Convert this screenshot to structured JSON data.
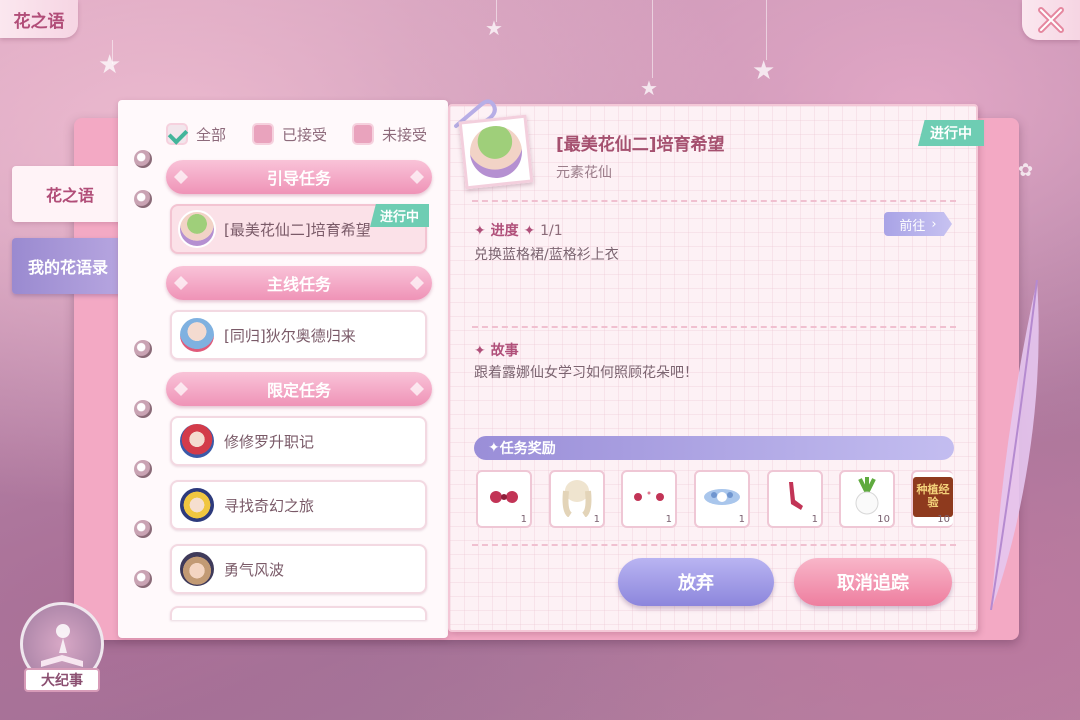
{
  "header": {
    "title": "花之语"
  },
  "side_tabs": [
    {
      "label": "花之语"
    },
    {
      "label": "我的花语录"
    }
  ],
  "filters": [
    {
      "label": "全部",
      "checked": true
    },
    {
      "label": "已接受",
      "checked": false
    },
    {
      "label": "未接受",
      "checked": false
    }
  ],
  "categories": [
    {
      "label": "引导任务"
    },
    {
      "label": "主线任务"
    },
    {
      "label": "限定任务"
    }
  ],
  "quests": [
    {
      "title": "[最美花仙二]培育希望",
      "status": "进行中",
      "selected": true
    },
    {
      "title": "[同归]狄尔奥德归来"
    },
    {
      "title": "修修罗升职记"
    },
    {
      "title": "寻找奇幻之旅"
    },
    {
      "title": "勇气风波"
    }
  ],
  "detail": {
    "title": "[最美花仙二]培育希望",
    "subtitle": "元素花仙",
    "status": "进行中",
    "progress_label": "进度",
    "progress_value": "1/1",
    "goto_label": "前往",
    "task_text": "兑换蓝格裙/蓝格衫上衣",
    "story_label": "故事",
    "story_text": "跟着露娜仙女学习如何照顾花朵吧！",
    "reward_label": "任务奖励",
    "rewards": [
      {
        "icon": "red-bow-icon",
        "count": "1"
      },
      {
        "icon": "hair-wig-icon",
        "count": "1"
      },
      {
        "icon": "red-earrings-icon",
        "count": "1"
      },
      {
        "icon": "blue-headband-icon",
        "count": "1"
      },
      {
        "icon": "red-heels-icon",
        "count": "1"
      },
      {
        "icon": "turnip-icon",
        "count": "10"
      },
      {
        "icon": "exp-book-icon",
        "count": "10",
        "text": "种植经验"
      }
    ]
  },
  "buttons": {
    "abandon": "放弃",
    "untrack": "取消追踪"
  },
  "emblem": {
    "label": "大纪事"
  },
  "colors": {
    "accent": "#ef93b7",
    "status": "#6ecdb3",
    "purple": "#9a8ed8"
  }
}
